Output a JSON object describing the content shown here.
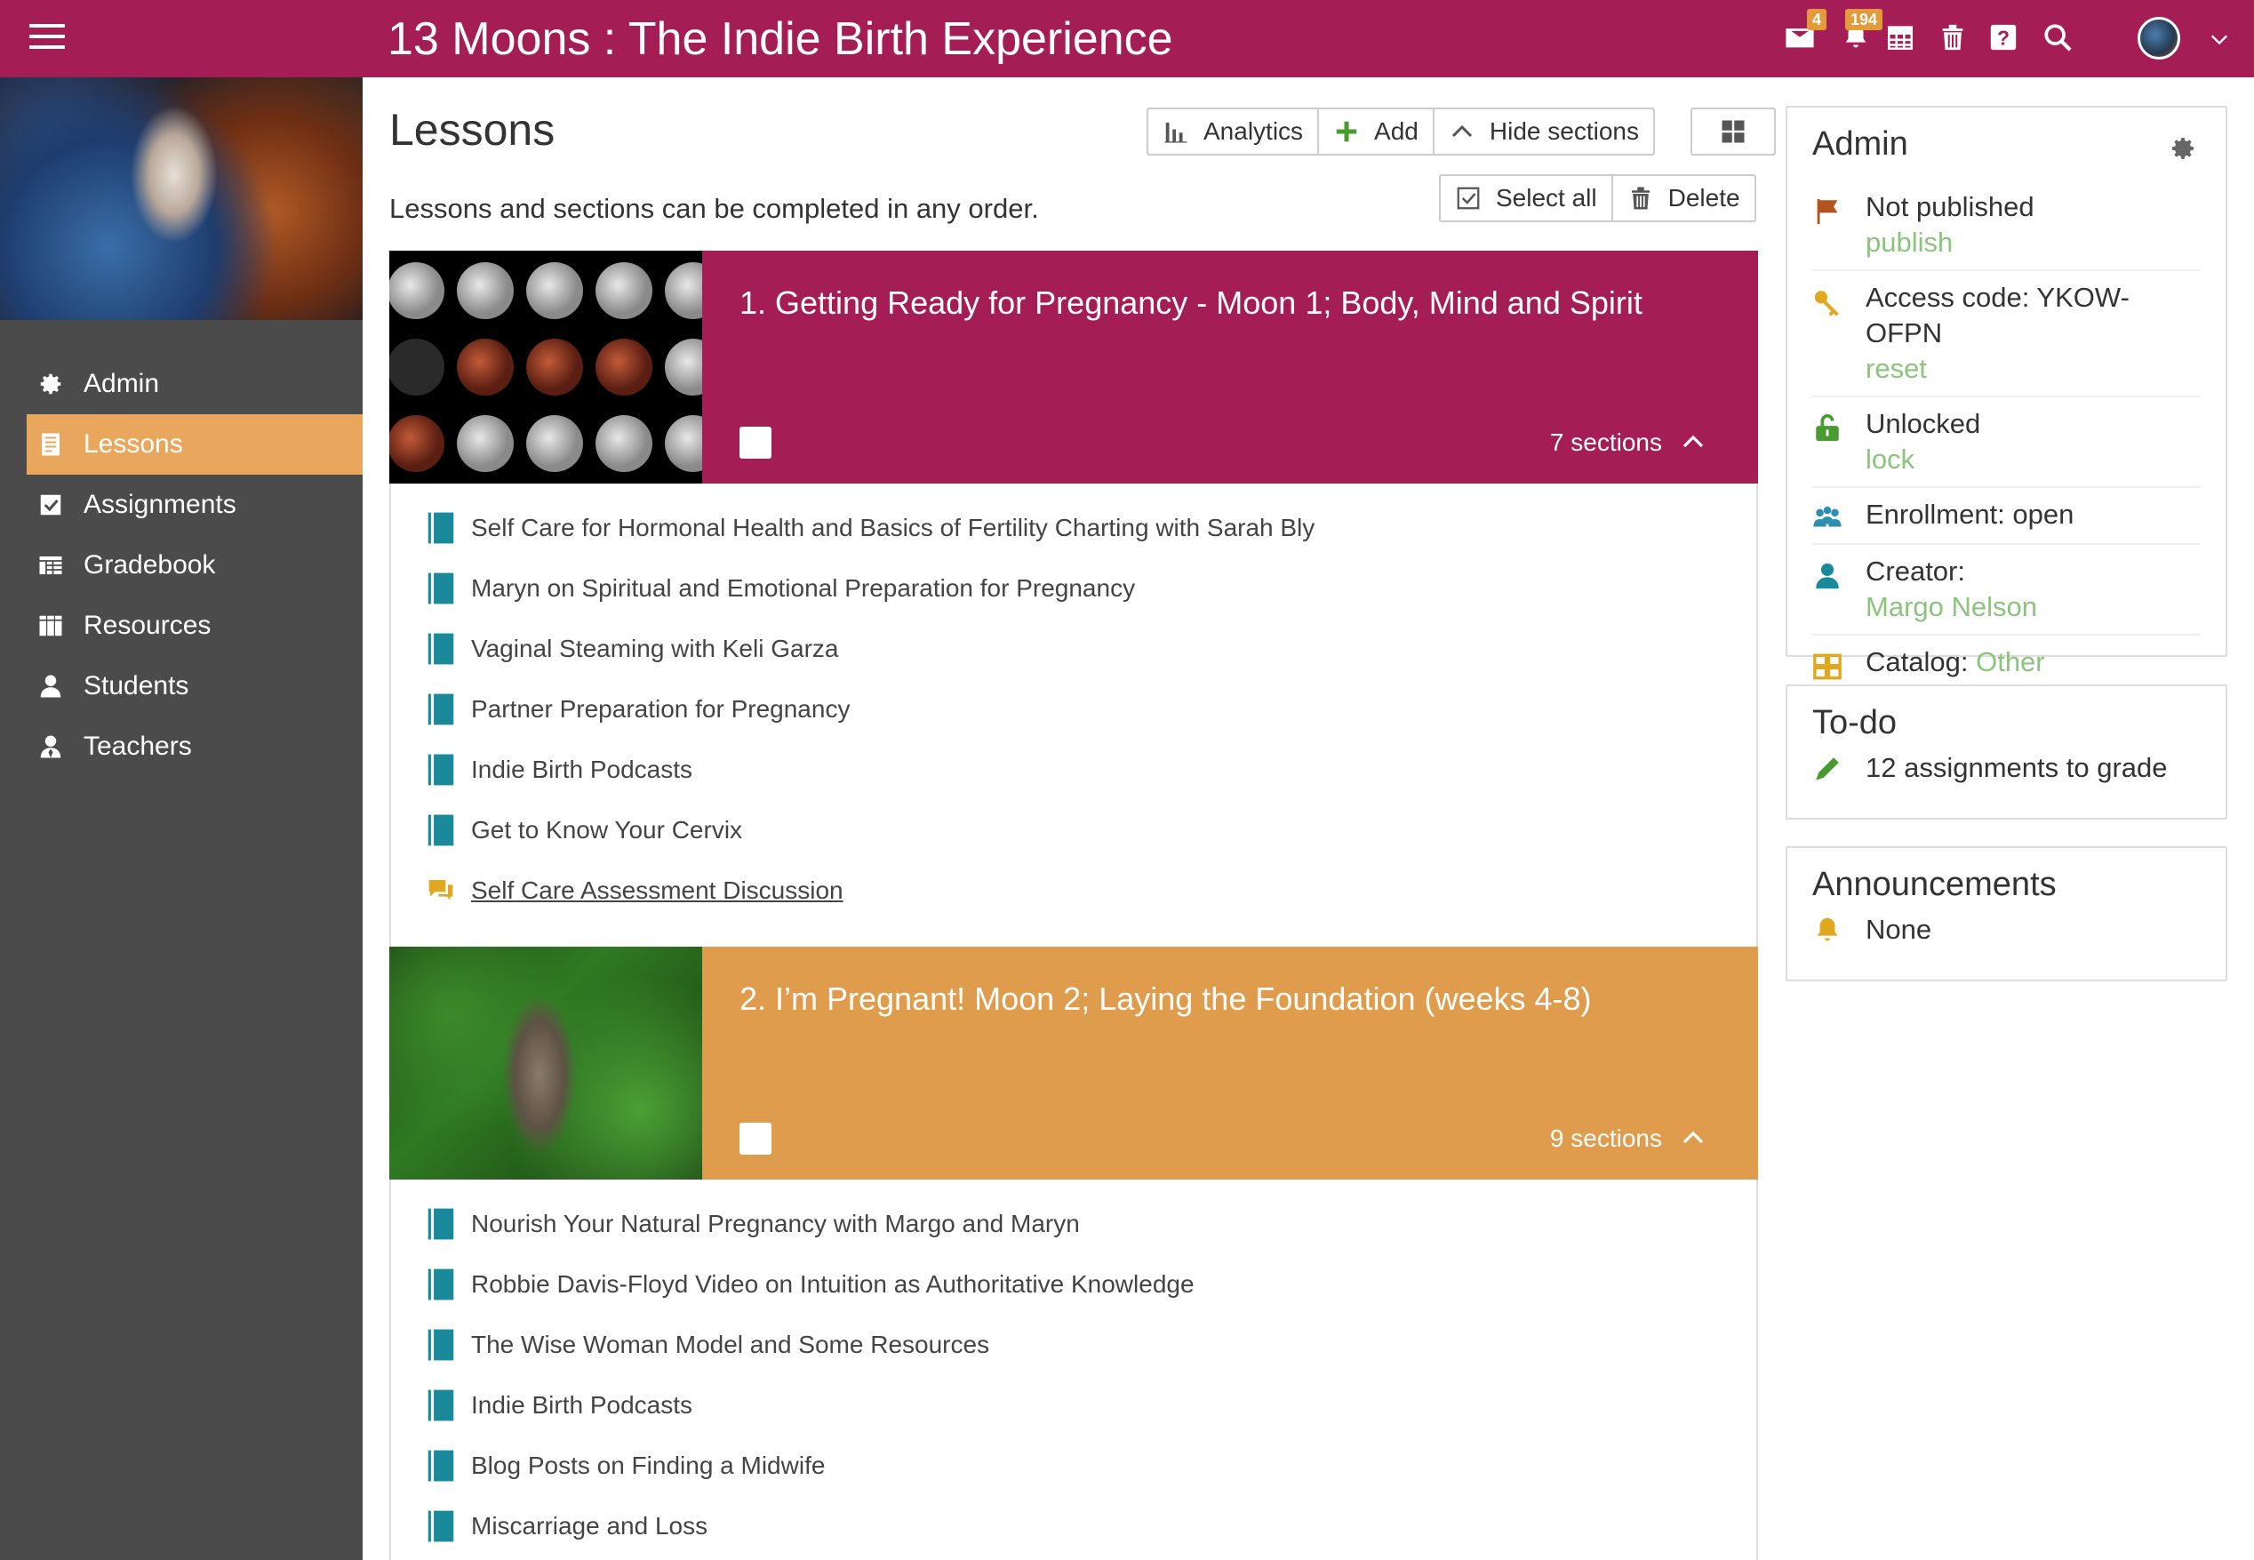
{
  "header": {
    "title": "13 Moons : The Indie Birth Experience",
    "mail_badge": "4",
    "notifications_badge": "194",
    "colors": {
      "primary": "#a51d55",
      "accent": "#e39a3b"
    }
  },
  "sidebar": {
    "items": [
      {
        "label": "Admin",
        "icon": "gear-icon",
        "active": false
      },
      {
        "label": "Lessons",
        "icon": "lessons-icon",
        "active": true
      },
      {
        "label": "Assignments",
        "icon": "checkbox-icon",
        "active": false
      },
      {
        "label": "Gradebook",
        "icon": "gradebook-icon",
        "active": false
      },
      {
        "label": "Resources",
        "icon": "resources-icon",
        "active": false
      },
      {
        "label": "Students",
        "icon": "person-icon",
        "active": false
      },
      {
        "label": "Teachers",
        "icon": "teacher-icon",
        "active": false
      }
    ]
  },
  "main": {
    "title": "Lessons",
    "intro": "Lessons and sections can be completed in any order.",
    "toolbar": {
      "analytics": "Analytics",
      "add": "Add",
      "hide_sections": "Hide sections",
      "select_all": "Select all",
      "delete": "Delete"
    },
    "lessons": [
      {
        "title": "1. Getting Ready for Pregnancy - Moon 1; Body, Mind and Spirit",
        "sections_count": "7 sections",
        "color": "#a51d55",
        "sections": [
          {
            "label": "Self Care for Hormonal Health and Basics of Fertility Charting with Sarah Bly",
            "type": "book"
          },
          {
            "label": "Maryn on Spiritual and Emotional Preparation for Pregnancy",
            "type": "book"
          },
          {
            "label": "Vaginal Steaming with Keli Garza",
            "type": "book"
          },
          {
            "label": "Partner Preparation for Pregnancy",
            "type": "book"
          },
          {
            "label": "Indie Birth Podcasts",
            "type": "book"
          },
          {
            "label": "Get to Know Your Cervix",
            "type": "book"
          },
          {
            "label": "Self Care Assessment Discussion",
            "type": "discussion"
          }
        ]
      },
      {
        "title": "2. I’m Pregnant! Moon 2; Laying the Foundation (weeks 4-8)",
        "sections_count": "9 sections",
        "color": "#e09c4d",
        "sections": [
          {
            "label": "Nourish Your Natural Pregnancy with Margo and Maryn",
            "type": "book"
          },
          {
            "label": "Robbie Davis-Floyd Video on Intuition as Authoritative Knowledge",
            "type": "book"
          },
          {
            "label": "The Wise Woman Model and Some Resources",
            "type": "book"
          },
          {
            "label": "Indie Birth Podcasts",
            "type": "book"
          },
          {
            "label": "Blog Posts on Finding a Midwife",
            "type": "book"
          },
          {
            "label": "Miscarriage and Loss",
            "type": "book"
          }
        ]
      }
    ]
  },
  "admin_panel": {
    "title": "Admin",
    "status": "Not published",
    "status_action": "publish",
    "access_code": "Access code: YKOW-OFPN",
    "access_action": "reset",
    "lock_status": "Unlocked",
    "lock_action": "lock",
    "enrollment": "Enrollment: open",
    "creator_label": "Creator:",
    "creator_name": "Margo Nelson",
    "catalog_label": "Catalog:",
    "catalog_value": "Other"
  },
  "todo_panel": {
    "title": "To-do",
    "item": "12 assignments to grade"
  },
  "announcements_panel": {
    "title": "Announcements",
    "item": "None"
  }
}
